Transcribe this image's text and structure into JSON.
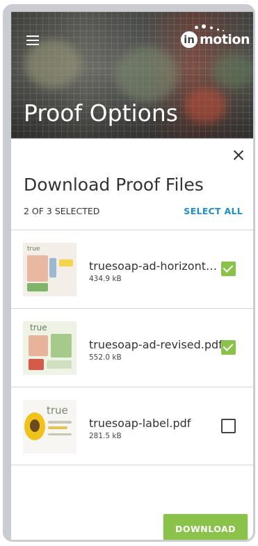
{
  "header": {
    "title": "Proof Options",
    "logo_text": "motion",
    "logo_initial": "in"
  },
  "dialog": {
    "title": "Download Proof Files",
    "selection_count": "2 OF 3 SELECTED",
    "select_all_label": "SELECT ALL",
    "download_label": "DOWNLOAD",
    "files": [
      {
        "name": "truesoap-ad-horizontal.pdf",
        "size": "434.9 kB",
        "selected": true
      },
      {
        "name": "truesoap-ad-revised.pdf",
        "size": "552.0 kB",
        "selected": true
      },
      {
        "name": "truesoap-label.pdf",
        "size": "281.5 kB",
        "selected": false
      }
    ]
  },
  "colors": {
    "accent_green": "#8bc34a",
    "link_blue": "#1a8fc9",
    "text_dark": "#333333"
  },
  "icons": [
    "menu-icon",
    "close-icon",
    "checkbox-checked-icon",
    "checkbox-unchecked-icon"
  ]
}
